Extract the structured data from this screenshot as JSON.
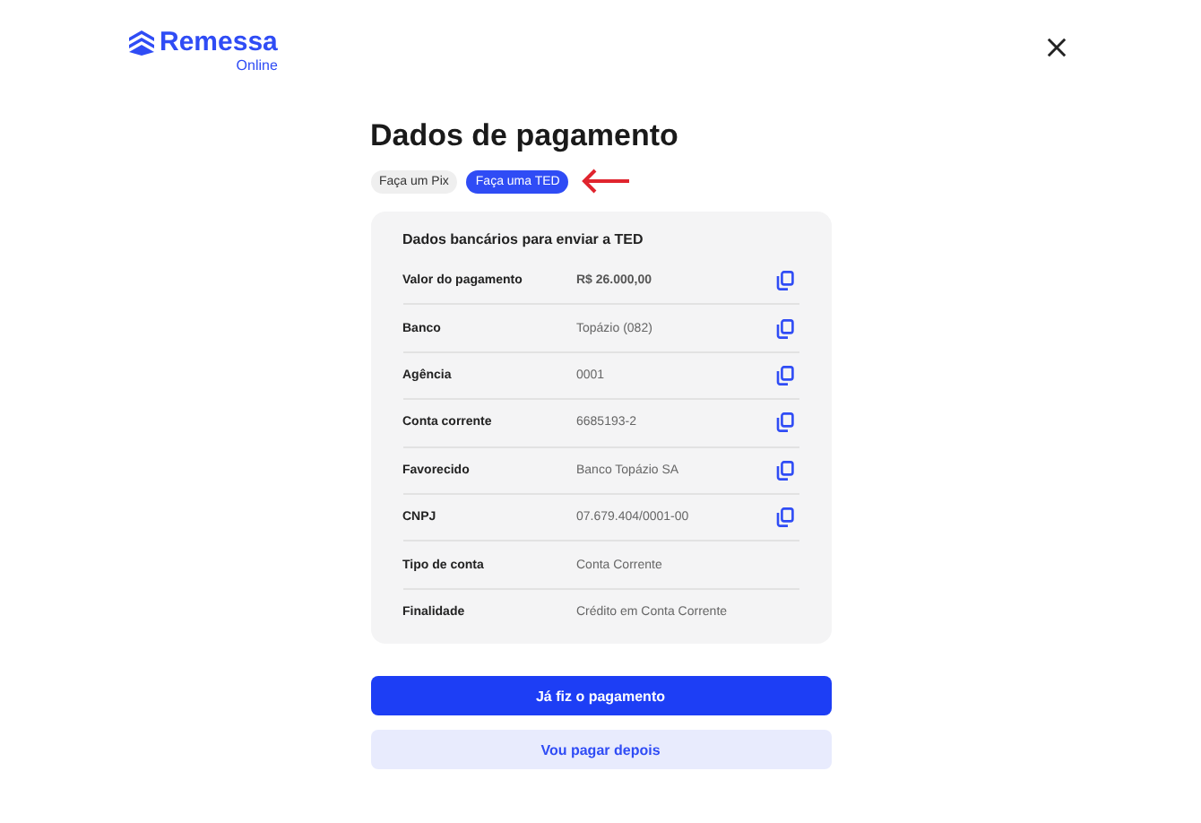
{
  "logo": {
    "name": "Remessa",
    "subtitle": "Online"
  },
  "title": "Dados de pagamento",
  "tabs": [
    {
      "label": "Faça um Pix",
      "selected": false
    },
    {
      "label": "Faça uma TED",
      "selected": true
    }
  ],
  "card": {
    "heading": "Dados bancários para enviar a TED",
    "rows": [
      {
        "label": "Valor do pagamento",
        "value": "R$ 26.000,00",
        "copyable": true,
        "emphasis": true
      },
      {
        "label": "Banco",
        "value": "Topázio (082)",
        "copyable": true,
        "emphasis": false
      },
      {
        "label": "Agência",
        "value": "0001",
        "copyable": true,
        "emphasis": false
      },
      {
        "label": "Conta corrente",
        "value": "6685193-2",
        "copyable": true,
        "emphasis": false
      },
      {
        "label": "Favorecido",
        "value": "Banco Topázio SA",
        "copyable": true,
        "emphasis": false
      },
      {
        "label": "CNPJ",
        "value": "07.679.404/0001-00",
        "copyable": true,
        "emphasis": false
      },
      {
        "label": "Tipo de conta",
        "value": "Conta Corrente",
        "copyable": false,
        "emphasis": false
      },
      {
        "label": "Finalidade",
        "value": "Crédito em Conta Corrente",
        "copyable": false,
        "emphasis": false
      }
    ]
  },
  "buttons": [
    {
      "label": "Já fiz o pagamento",
      "kind": "primary"
    },
    {
      "label": "Vou pagar depois",
      "kind": "secondary"
    }
  ]
}
